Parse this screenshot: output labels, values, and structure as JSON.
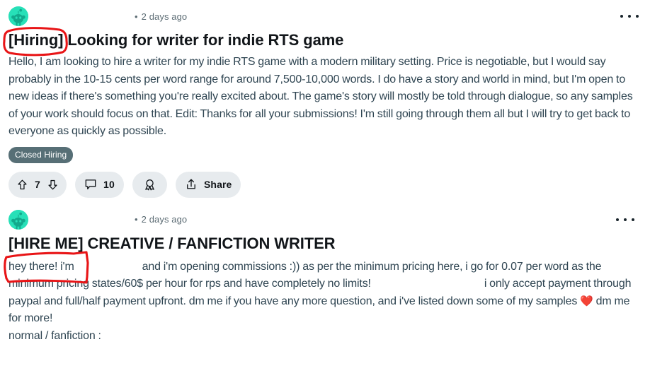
{
  "posts": [
    {
      "avatar_icon": "reddit-snoo-avatar",
      "author": "",
      "separator": "•",
      "age": "2 days ago",
      "overflow_icon": "overflow-menu-icon",
      "title_tag": "[Hiring]",
      "title_rest": "Looking for writer for indie RTS game",
      "body_part_1": "Hello, I am looking to hire a writer for my indie RTS game with a modern military setting. Price is negotiable, but I would say probably in the 10-15 cents per word range for around 7,500-10,000 words. I do have a story and world in mind, but I'm open to new ideas if there's something you're really excited about. The game's story will mostly be told through dialogue, so any samples of your work should focus on that. Edit: Thanks for all your submissions! I'm still going through them all but I will try to get back to everyone as quickly as possible.",
      "flair": "Closed Hiring",
      "upvote_icon": "upvote-arrow-icon",
      "downvote_icon": "downvote-arrow-icon",
      "vote_count": "7",
      "comment_icon": "comment-bubble-icon",
      "comment_count": "10",
      "award_icon": "award-rosette-icon",
      "share_icon": "share-arrow-icon",
      "share_label": "Share"
    },
    {
      "avatar_icon": "reddit-snoo-avatar",
      "author": "",
      "separator": "•",
      "age": "2 days ago",
      "overflow_icon": "overflow-menu-icon",
      "title_tag": "[HIRE ME]",
      "title_rest": "CREATIVE / FANFICTION WRITER",
      "body_seg_1": "hey there! i'm",
      "body_seg_2": "and i'm opening commissions :)) as per the minimum pricing here, i go for 0.07 per word as the minimum pricing states/60$ per hour for rps and have completely no limits!",
      "body_seg_3": "i only accept payment through paypal and full/half payment upfront. dm me if you have any more question, and i've listed down some of my samples",
      "heart_icon": "heart-emoji",
      "body_seg_4": "dm me for more!",
      "body_seg_5": "normal / fanfiction :"
    }
  ],
  "annotations": [
    {
      "name": "hiring-tag-highlight",
      "shape": "hand-drawn-rounded-rect",
      "color": "#e81416"
    },
    {
      "name": "hire-me-tag-highlight",
      "shape": "hand-drawn-polygon",
      "color": "#e81416"
    }
  ],
  "colors": {
    "avatar_bg": "#27e0b8",
    "avatar_fg": "#12a98c",
    "flair_bg": "#576f76",
    "pill_bg": "#e7ebee",
    "body_text": "#2f4552",
    "annotation": "#e81416"
  }
}
